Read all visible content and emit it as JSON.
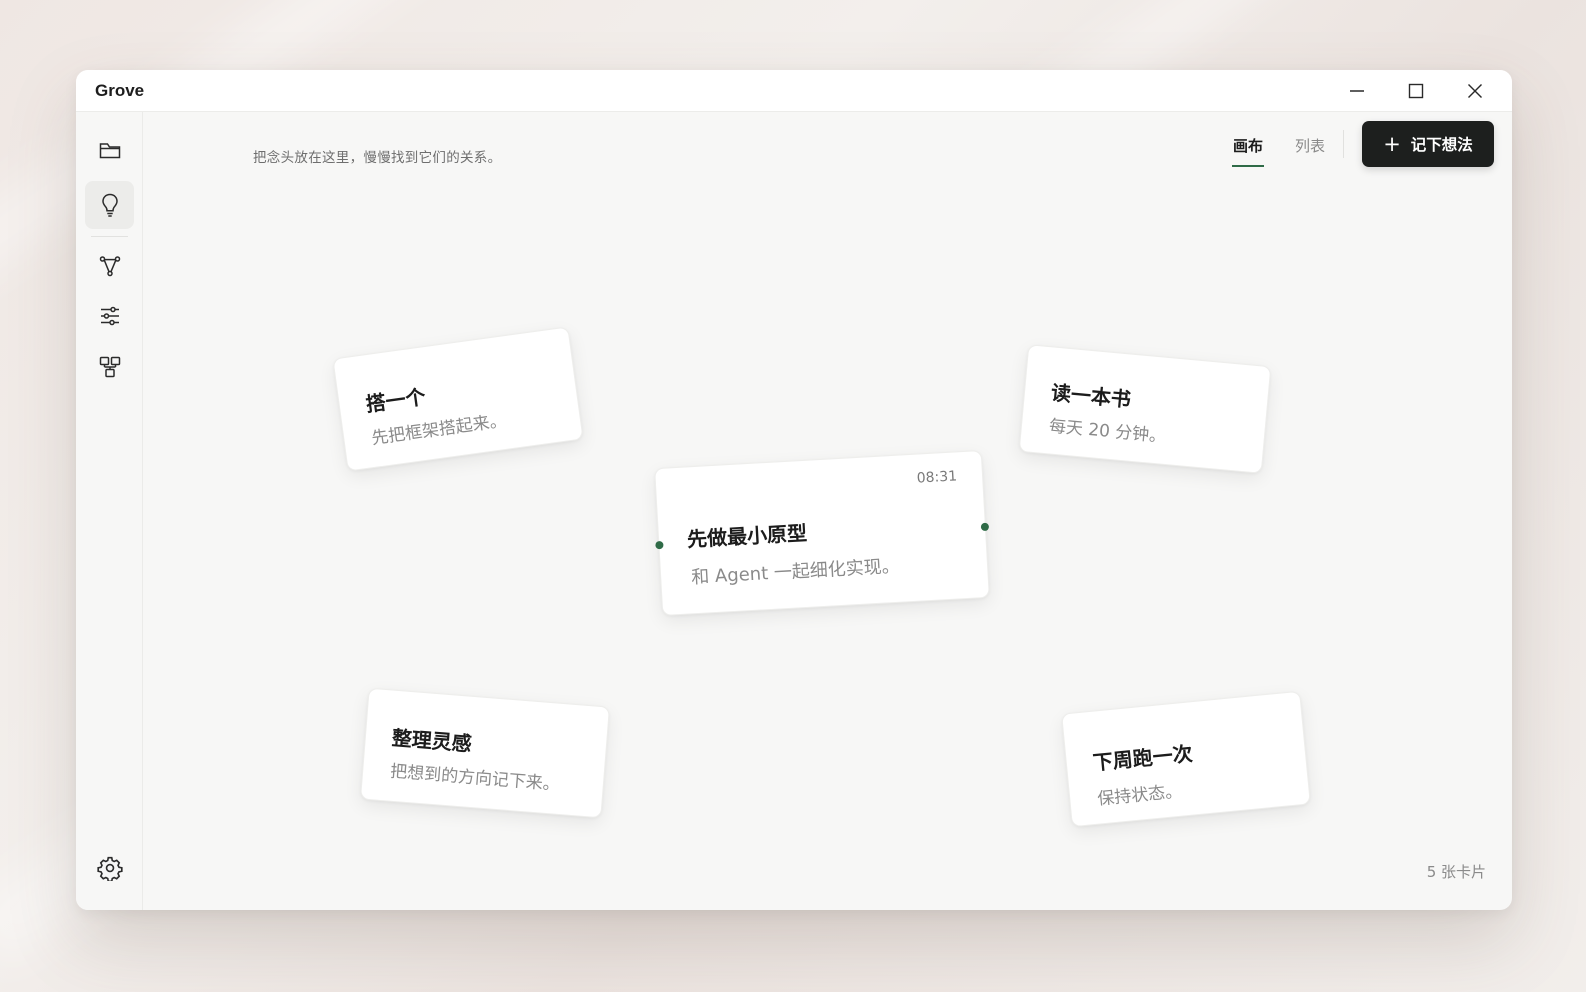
{
  "window": {
    "title": "Grove"
  },
  "header": {
    "subtitle": "把念头放在这里，慢慢找到它们的关系。",
    "tabs": [
      {
        "label": "画布",
        "active": true
      },
      {
        "label": "列表",
        "active": false
      }
    ],
    "add_button": {
      "icon": "plus-icon",
      "label": "记下想法"
    }
  },
  "sidebar": {
    "items": [
      {
        "icon": "folder-icon",
        "active": false
      },
      {
        "icon": "lightbulb-icon",
        "active": true
      },
      {
        "icon": "graph-icon",
        "active": false
      },
      {
        "icon": "sliders-icon",
        "active": false
      },
      {
        "icon": "modules-icon",
        "active": false
      }
    ],
    "settings_icon": "gear-icon"
  },
  "cards": [
    {
      "title": "搭一个",
      "desc": "先把框架搭起来。"
    },
    {
      "title": "读一本书",
      "desc": "每天 20 分钟。"
    },
    {
      "title": "先做最小原型",
      "desc": "和 Agent 一起细化实现。",
      "time": "08:31"
    },
    {
      "title": "整理灵感",
      "desc": "把想到的方向记下来。"
    },
    {
      "title": "下周跑一次",
      "desc": "保持状态。"
    }
  ],
  "footer": {
    "count": "5 张卡片"
  },
  "colors": {
    "accent": "#2f6b47",
    "button_bg": "#1d1f1e"
  }
}
